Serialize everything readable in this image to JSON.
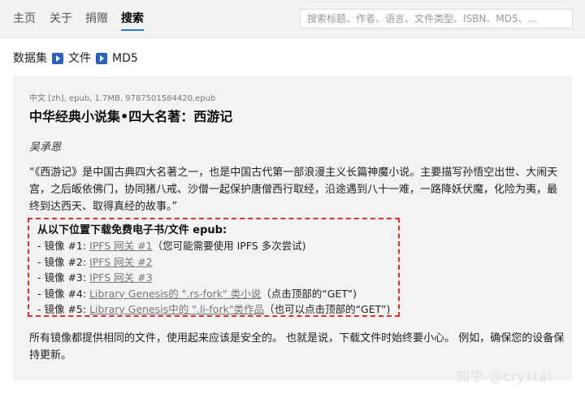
{
  "nav": {
    "items": [
      {
        "label": "主页"
      },
      {
        "label": "关于"
      },
      {
        "label": "捐赠"
      },
      {
        "label": "搜索"
      }
    ],
    "search_placeholder": "搜索标题、作者、语言、文件类型、ISBN、MD5、..."
  },
  "breadcrumb": {
    "items": [
      "数据集",
      "文件",
      "MD5"
    ]
  },
  "book": {
    "meta": "中文 [zh], epub, 1.7MB, 9787501584420.epub",
    "title": "中华经典小说集•四大名著：西游记",
    "author": "吴承恩",
    "description": "“《西游记》是中国古典四大名著之一，也是中国古代第一部浪漫主义长篇神魔小说。主要描写孙悟空出世、大闹天宫，之后皈依佛门，协同猪八戒、沙僧一起保护唐僧西行取经，沿途遇到八十一难，一路降妖伏魔，化险为夷，最终到达西天、取得真经的故事。”"
  },
  "download": {
    "heading": "从以下位置下载免费电子书/文件 epub:",
    "mirrors": [
      {
        "prefix": "- 镜像 #1: ",
        "link": "IPFS 网关 #1",
        "note": "（您可能需要使用 IPFS 多次尝试)"
      },
      {
        "prefix": "- 镜像 #2: ",
        "link": "IPFS 网关 #2",
        "note": ""
      },
      {
        "prefix": "- 镜像 #3: ",
        "link": "IPFS 网关 #3",
        "note": ""
      },
      {
        "prefix": "- 镜像 #4: ",
        "link": "Library Genesis的 \".rs-fork\" 类小说",
        "note": "（点击顶部的“GET”)"
      },
      {
        "prefix": "- 镜像 #5: ",
        "link": "Library Genesis中的 \".li-fork\"类作品",
        "note": "（也可以点击顶部的“GET”)"
      }
    ],
    "footnote": "所有镜像都提供相同的文件，使用起来应该是安全的。 也就是说，下载文件时始终要小心。 例如，确保您的设备保持更新。"
  },
  "watermark": "知乎 @crystal"
}
